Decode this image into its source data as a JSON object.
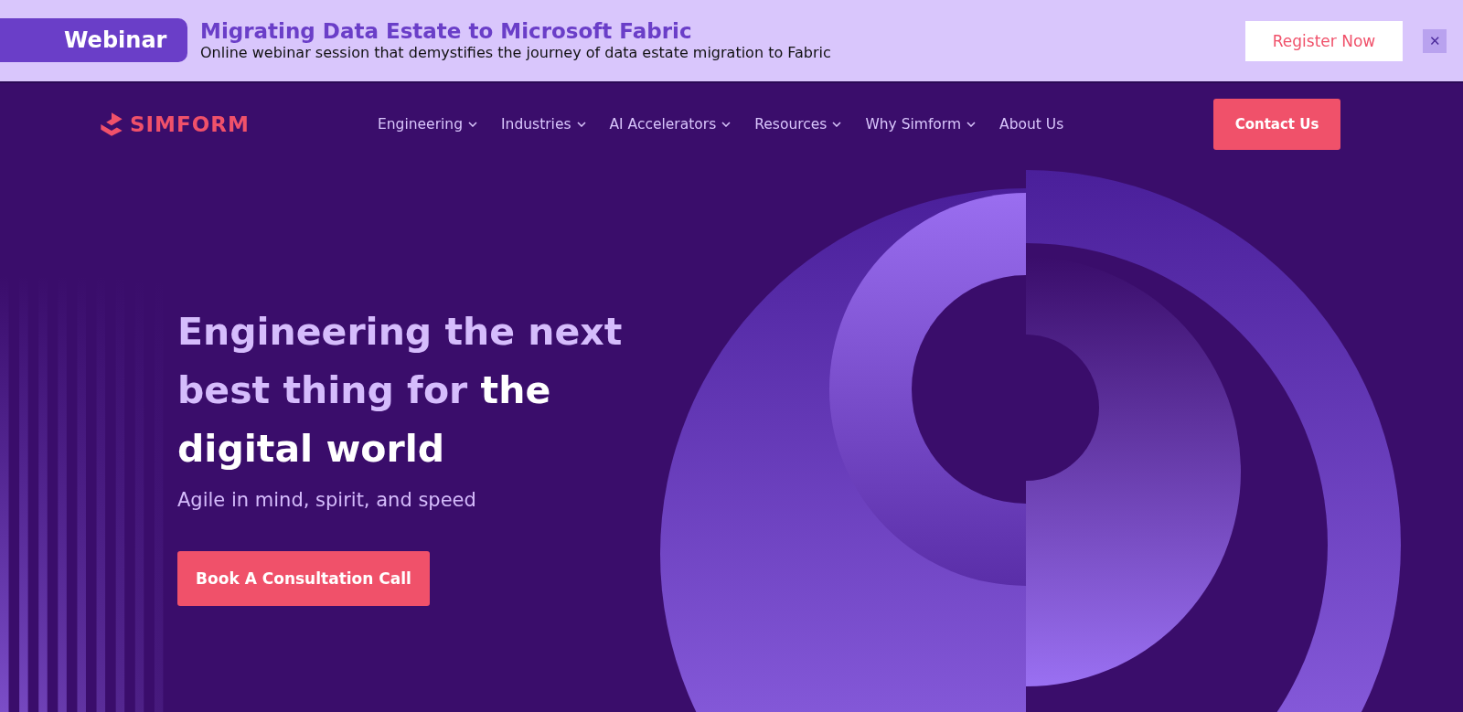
{
  "banner": {
    "tag": "Webinar",
    "title": "Migrating Data Estate to Microsoft Fabric",
    "subtitle": "Online webinar session that demystifies the journey of data estate migration to Fabric",
    "action": "Register Now",
    "close": "✕"
  },
  "nav": {
    "logo": "SIMFORM",
    "items": [
      {
        "label": "Engineering",
        "dropdown": true
      },
      {
        "label": "Industries",
        "dropdown": true
      },
      {
        "label": "AI Accelerators",
        "dropdown": true
      },
      {
        "label": "Resources",
        "dropdown": true
      },
      {
        "label": "Why Simform",
        "dropdown": true
      },
      {
        "label": "About Us",
        "dropdown": false
      }
    ],
    "action": "Contact Us"
  },
  "hero": {
    "headline": [
      {
        "text": "Engineering the next best thing for",
        "highlight": false
      },
      {
        "text": "the digital world",
        "highlight": true
      }
    ],
    "tagline": "Agile in mind, spirit, and speed",
    "action": "Book A Consultation Call"
  }
}
